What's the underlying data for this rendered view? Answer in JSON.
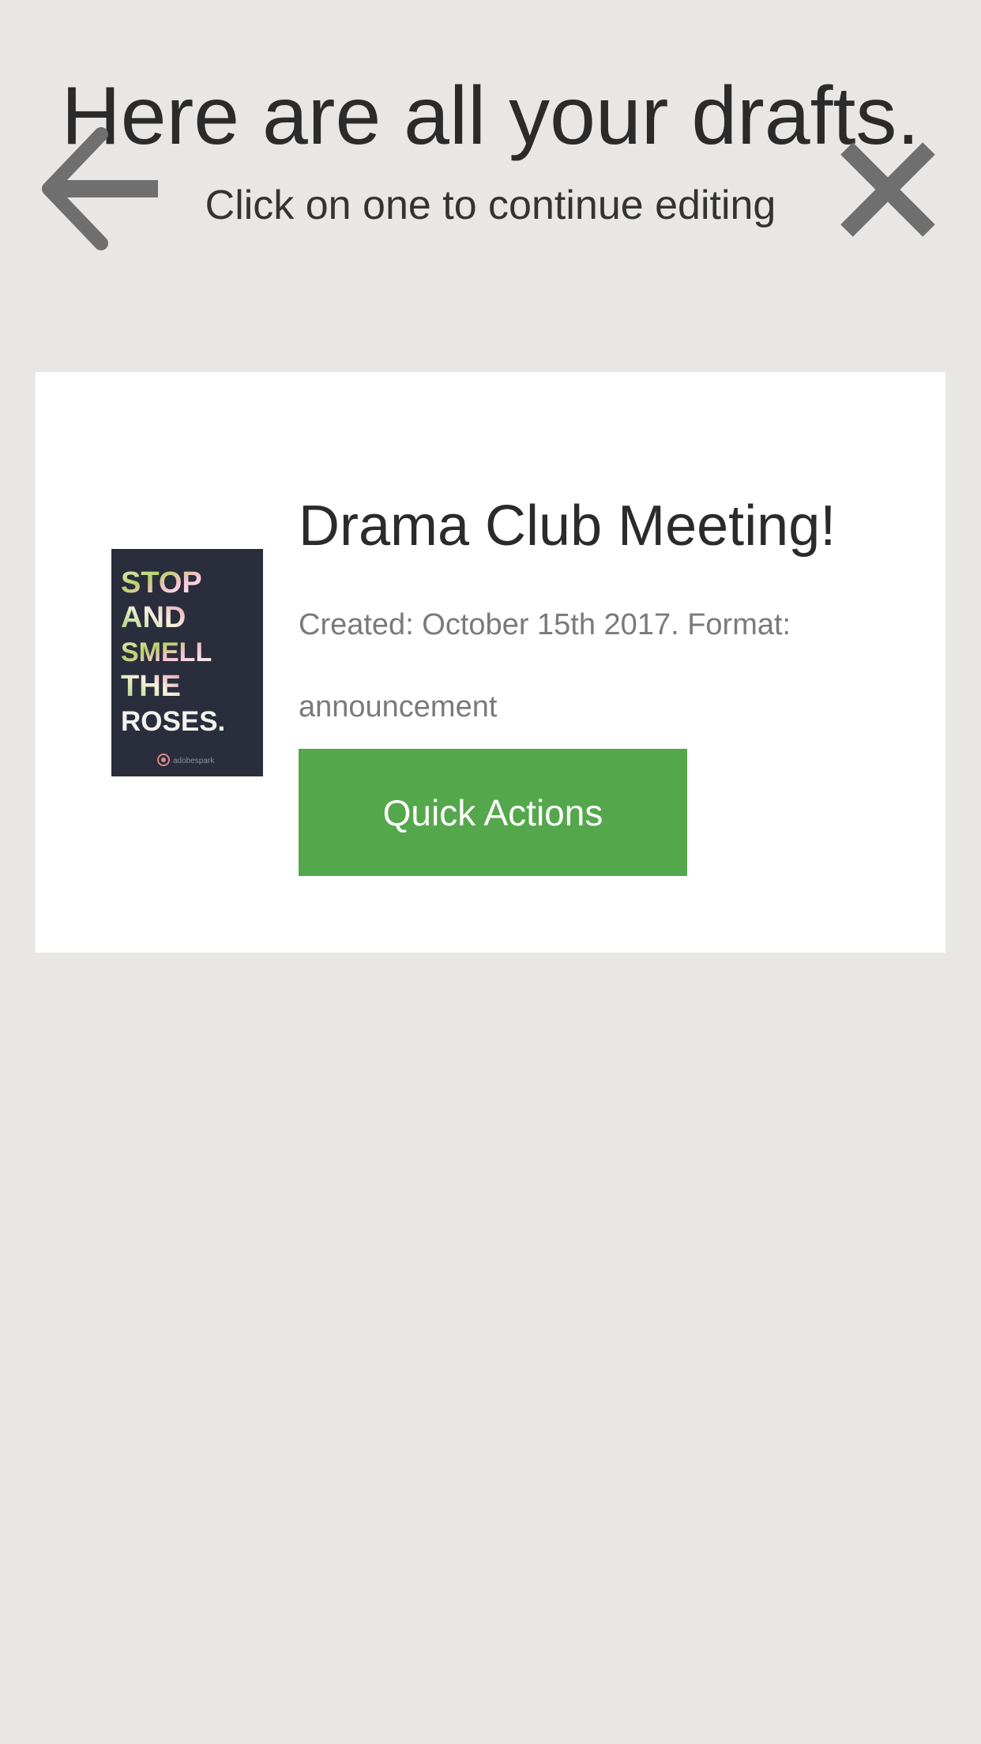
{
  "header": {
    "title": "Here are all your drafts.",
    "subtitle": "Click on one to continue editing"
  },
  "icons": {
    "back": "back-arrow-icon",
    "close": "close-icon"
  },
  "drafts": [
    {
      "title": "Drama Club Meeting!",
      "meta": "Created: October 15th 2017. Format: announcement",
      "action_label": "Quick Actions",
      "thumbnail": {
        "lines": [
          "STOP",
          "AND",
          "SMELL",
          "THE",
          "ROSES."
        ],
        "brand": "adobespark"
      }
    }
  ],
  "colors": {
    "background": "#e8e7e6",
    "card": "#ffffff",
    "accent": "#55a74b",
    "icon": "#6f6f6f",
    "title_text": "#2b2b2b",
    "meta_text": "#7a7a7a",
    "thumbnail_bg": "#2a2d3b"
  }
}
